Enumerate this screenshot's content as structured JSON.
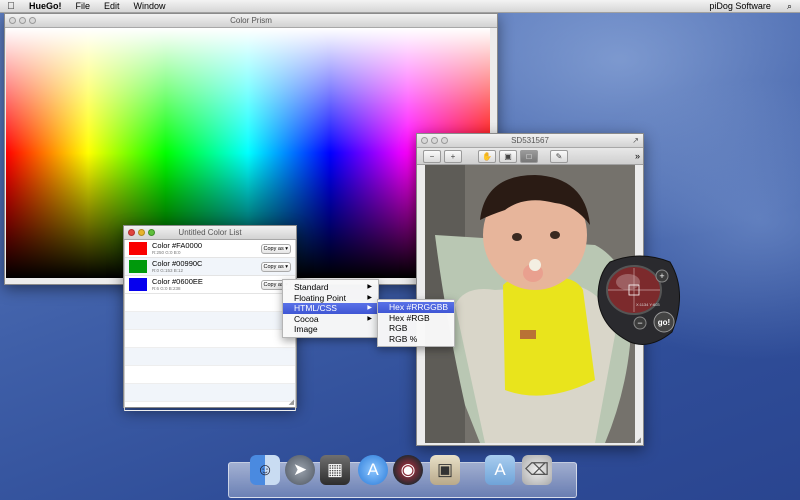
{
  "menubar": {
    "app": "HueGo!",
    "file": "File",
    "edit": "Edit",
    "window": "Window",
    "right": "piDog Software"
  },
  "prism_window": {
    "title": "Color Prism"
  },
  "photo_window": {
    "title": "SD531567"
  },
  "color_list": {
    "title": "Untitled Color List",
    "items": [
      {
        "name": "Color #FA0000",
        "sub": "R:250 G:0 B:0",
        "color": "#fa0000",
        "copy": "Copy as"
      },
      {
        "name": "Color #00990C",
        "sub": "R:0 G:153 B:12",
        "color": "#00990c",
        "copy": "Copy as"
      },
      {
        "name": "Color #0600EE",
        "sub": "R:6 G:0 B:238",
        "color": "#0600ee",
        "copy": "Copy as"
      }
    ]
  },
  "context_menu": {
    "items": [
      "Standard",
      "Floating Point",
      "HTML/CSS",
      "Cocoa",
      "Image"
    ],
    "highlighted": "HTML/CSS"
  },
  "submenu": {
    "items": [
      "Hex #RRGGBB",
      "Hex #RGB",
      "RGB",
      "RGB %"
    ],
    "highlighted": "Hex #RRGGBB"
  },
  "loupe": {
    "button": "go!",
    "coords": "X:1134 Y:603",
    "plus": "+",
    "minus": "−"
  }
}
